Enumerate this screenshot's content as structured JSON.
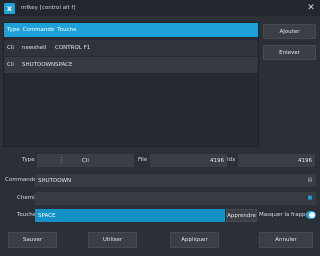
{
  "window": {
    "title": "mfkey [control alt f]"
  },
  "table": {
    "headers": [
      "Type",
      "Commande",
      "Touche"
    ],
    "rows": [
      {
        "type": "Cli",
        "command": "newshell",
        "key": "CONTROL F1"
      },
      {
        "type": "Cli",
        "command": "SHUTDOWN",
        "key": "SPACE"
      }
    ]
  },
  "side": {
    "add_label": "Ajouter",
    "remove_label": "Enlever"
  },
  "form": {
    "type_label": "Type",
    "type_value": "Cli",
    "file_label": "File",
    "file_value": "4196",
    "idx_label": "Idx",
    "idx_value": "4196",
    "command_label": "Commande",
    "command_value": "SHUTDOWN",
    "path_label": "Chemin",
    "path_value": "",
    "key_label": "Touche",
    "key_value": "SPACE",
    "learn_label": "Apprendre",
    "mask_label": "Masquer la frappe",
    "mask_on": true
  },
  "buttons": {
    "save": "Sauver",
    "use": "Utiliser",
    "apply": "Appliquer",
    "cancel": "Annuler"
  },
  "colors": {
    "accent": "#1ea0d8",
    "background": "#2b2f36"
  }
}
